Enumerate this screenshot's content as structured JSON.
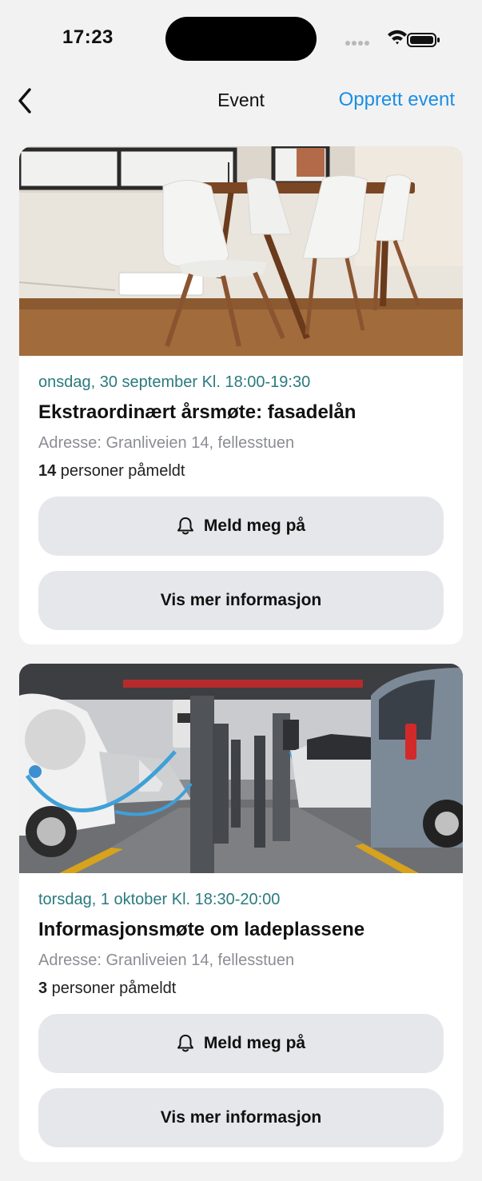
{
  "status": {
    "time": "17:23",
    "icons": [
      "signal-dots-icon",
      "wifi-icon",
      "battery-icon"
    ]
  },
  "nav": {
    "title": "Event",
    "action_label": "Opprett event",
    "action_color": "#1a8fe3",
    "back_icon": "chevron-left-icon"
  },
  "events": [
    {
      "date": "onsdag, 30 september Kl. 18:00-19:30",
      "title": "Ekstraordinært årsmøte: fasadelån",
      "address": "Adresse: Granliveien 14, fellesstuen",
      "attendee_count": "14",
      "attendee_suffix": " personer påmeldt",
      "register_label": "Meld meg på",
      "info_label": "Vis mer informasjon",
      "image": "meeting-room-photo"
    },
    {
      "date": "torsdag, 1 oktober Kl. 18:30-20:00",
      "title": "Informasjonsmøte om ladeplassene",
      "address": "Adresse: Granliveien 14, fellesstuen",
      "attendee_count": "3",
      "attendee_suffix": " personer påmeldt",
      "register_label": "Meld meg på",
      "info_label": "Vis mer informasjon",
      "image": "ev-charging-garage-photo"
    }
  ],
  "colors": {
    "date_text": "#2a7a7e",
    "address_text": "#8b8d93",
    "button_bg": "#e6e7ea",
    "page_bg": "#f2f2f3"
  }
}
